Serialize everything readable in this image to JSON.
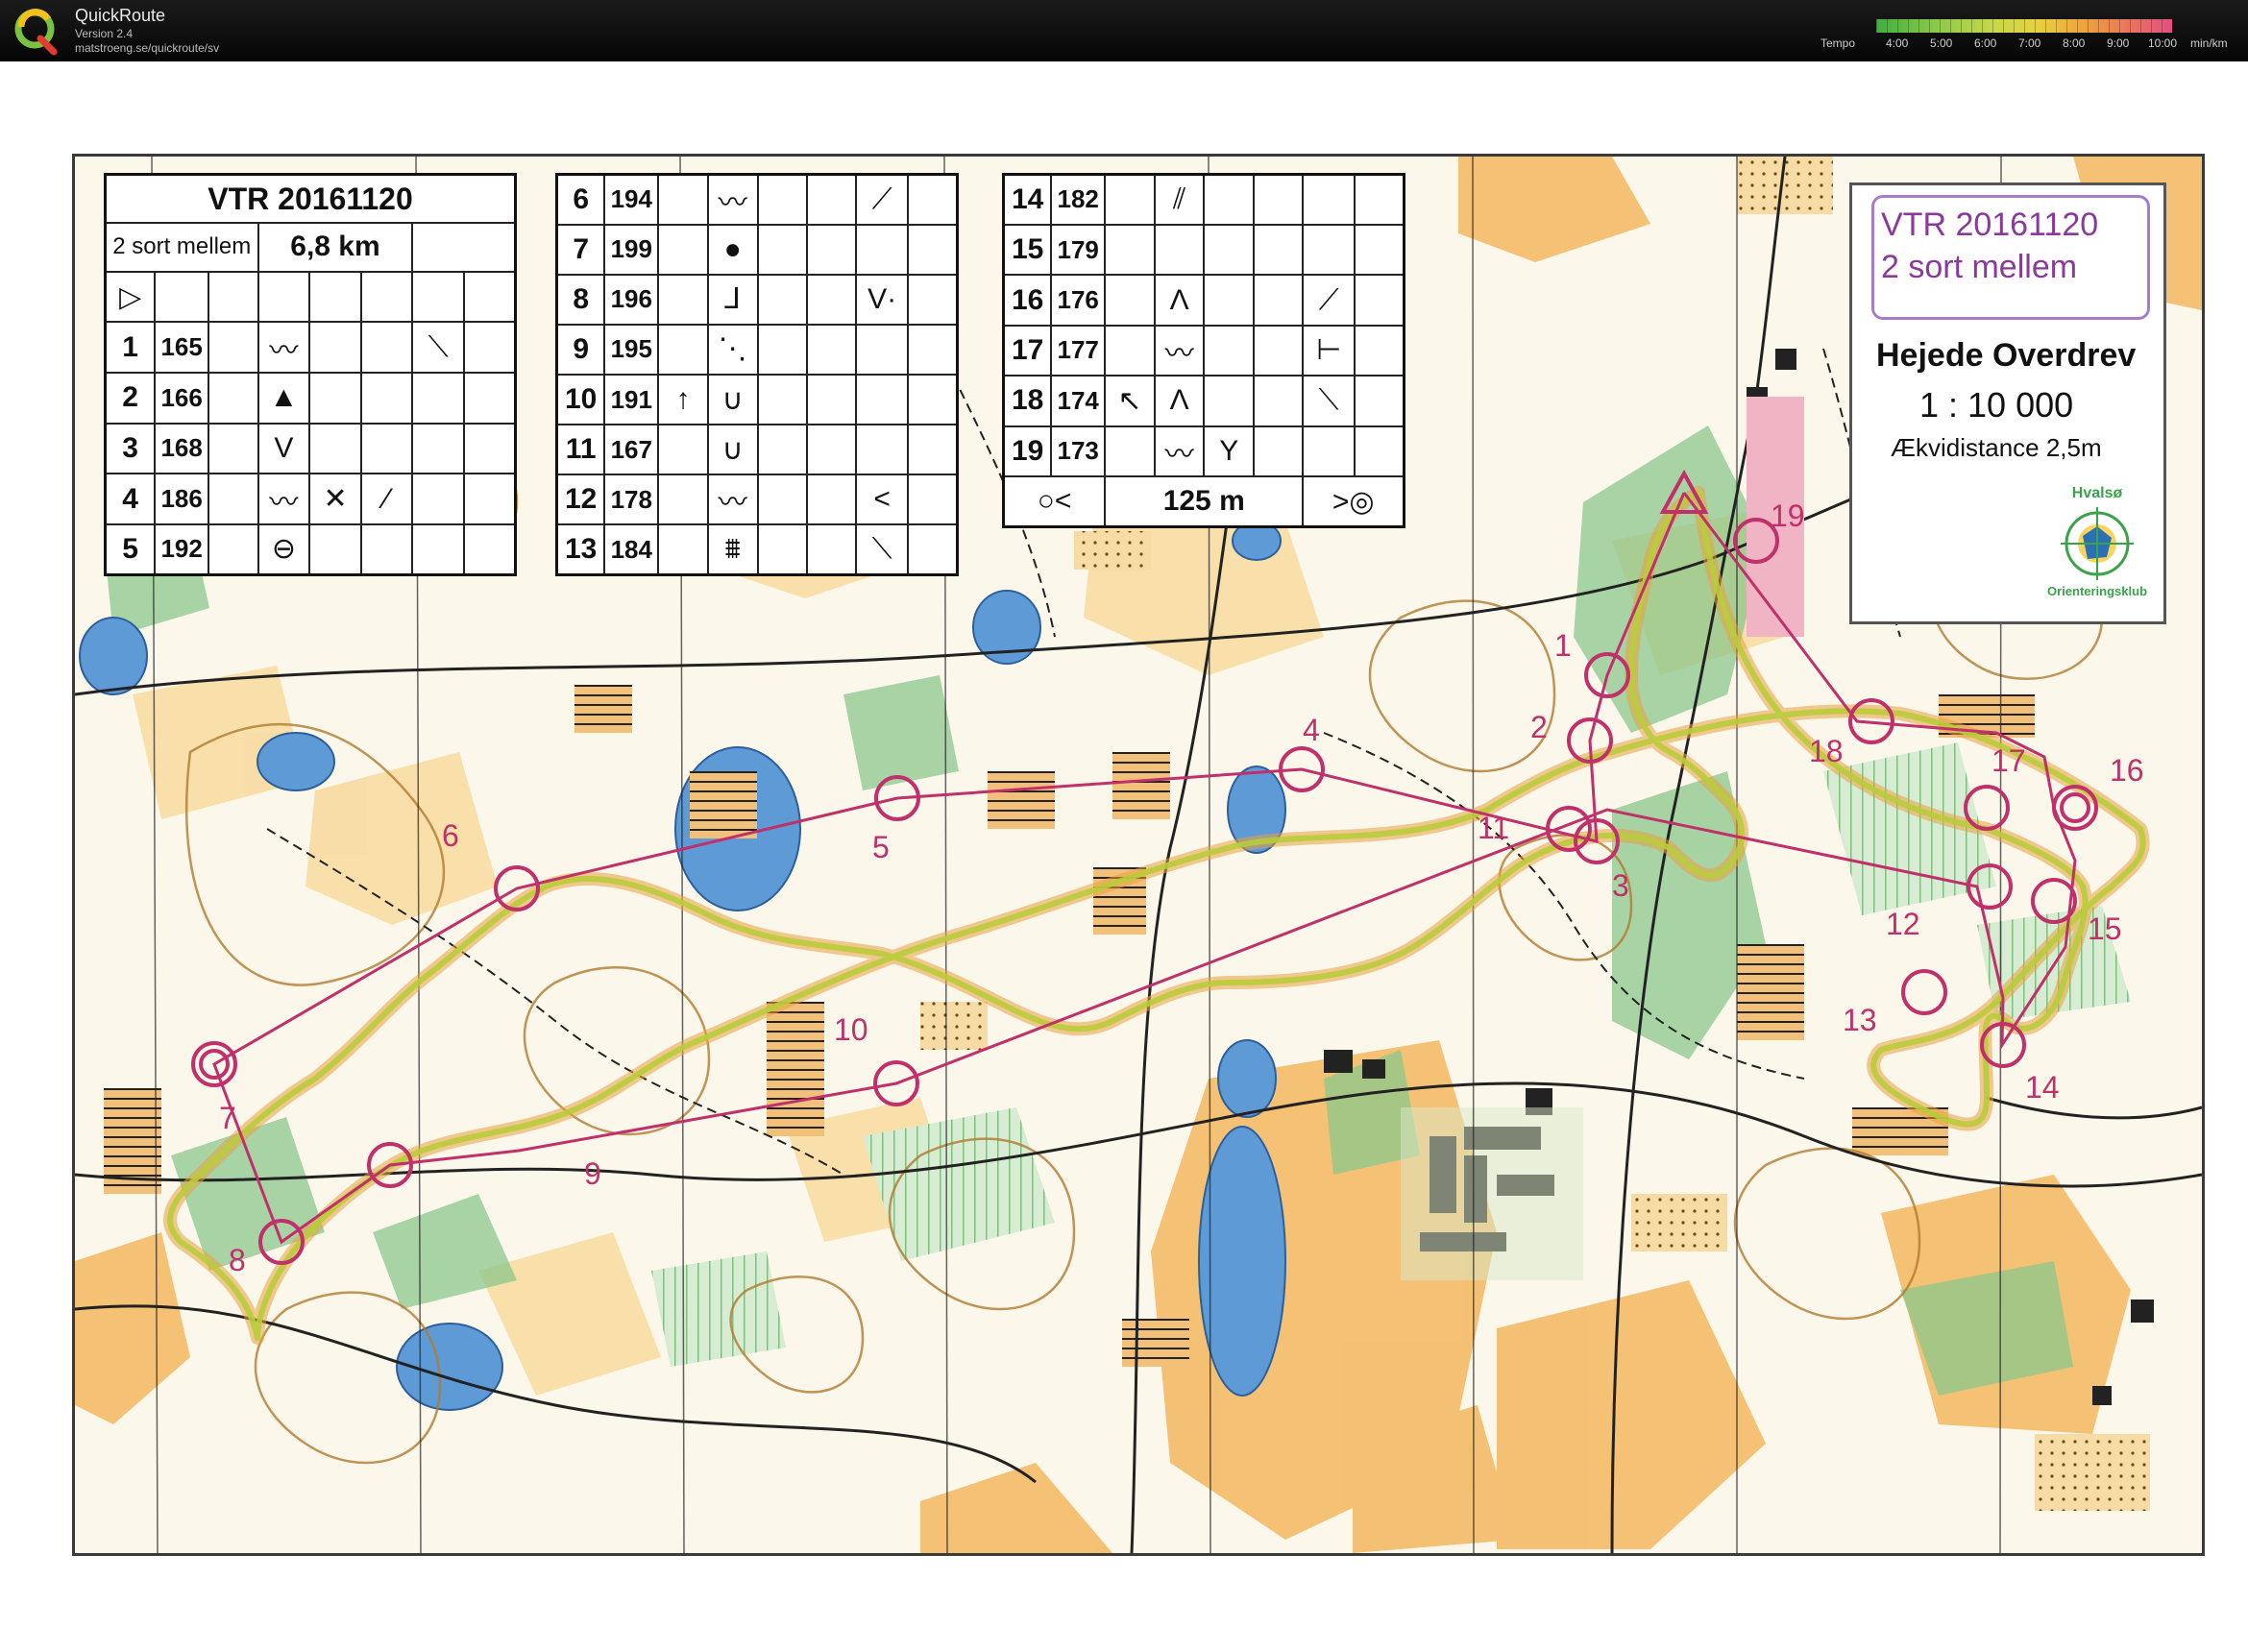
{
  "header": {
    "app_name": "QuickRoute",
    "version": "Version 2.4",
    "url": "matstroeng.se/quickroute/sv",
    "tempo_label": "Tempo",
    "tempo_ticks": [
      "4:00",
      "5:00",
      "6:00",
      "7:00",
      "8:00",
      "9:00",
      "10:00"
    ],
    "tempo_unit": "min/km",
    "tempo_colors": [
      "#3fae3f",
      "#c8d84a",
      "#e8d040",
      "#eda43c",
      "#e45080"
    ]
  },
  "title_box": {
    "course": "VTR 20161120",
    "class": "2 sort mellem",
    "area": "Hejede Overdrev",
    "scale": "1 : 10 000",
    "contour": "Ækvidistance 2,5m",
    "club_top": "Hvalsø",
    "club_bottom": "Orienteringsklub"
  },
  "descriptions": {
    "title": "VTR 20161120",
    "class": "2 sort mellem",
    "length": "6,8 km",
    "finish_distance": "125 m",
    "controls": [
      {
        "n": "1",
        "code": "165"
      },
      {
        "n": "2",
        "code": "166"
      },
      {
        "n": "3",
        "code": "168"
      },
      {
        "n": "4",
        "code": "186"
      },
      {
        "n": "5",
        "code": "192"
      },
      {
        "n": "6",
        "code": "194"
      },
      {
        "n": "7",
        "code": "199"
      },
      {
        "n": "8",
        "code": "196"
      },
      {
        "n": "9",
        "code": "195"
      },
      {
        "n": "10",
        "code": "191"
      },
      {
        "n": "11",
        "code": "167"
      },
      {
        "n": "12",
        "code": "178"
      },
      {
        "n": "13",
        "code": "184"
      },
      {
        "n": "14",
        "code": "182"
      },
      {
        "n": "15",
        "code": "179"
      },
      {
        "n": "16",
        "code": "176"
      },
      {
        "n": "17",
        "code": "177"
      },
      {
        "n": "18",
        "code": "174"
      },
      {
        "n": "19",
        "code": "173"
      }
    ]
  },
  "map_labels": [
    "1",
    "2",
    "3",
    "4",
    "5",
    "6",
    "7",
    "8",
    "9",
    "10",
    "11",
    "12",
    "13",
    "14",
    "15",
    "16",
    "17",
    "18",
    "19"
  ],
  "map_colors": {
    "course": "#c0306a",
    "route": "#d6c23a",
    "water": "#5d9ad6",
    "open": "#f2b760",
    "green": "#7fbf7f",
    "contour": "#b07a30"
  }
}
